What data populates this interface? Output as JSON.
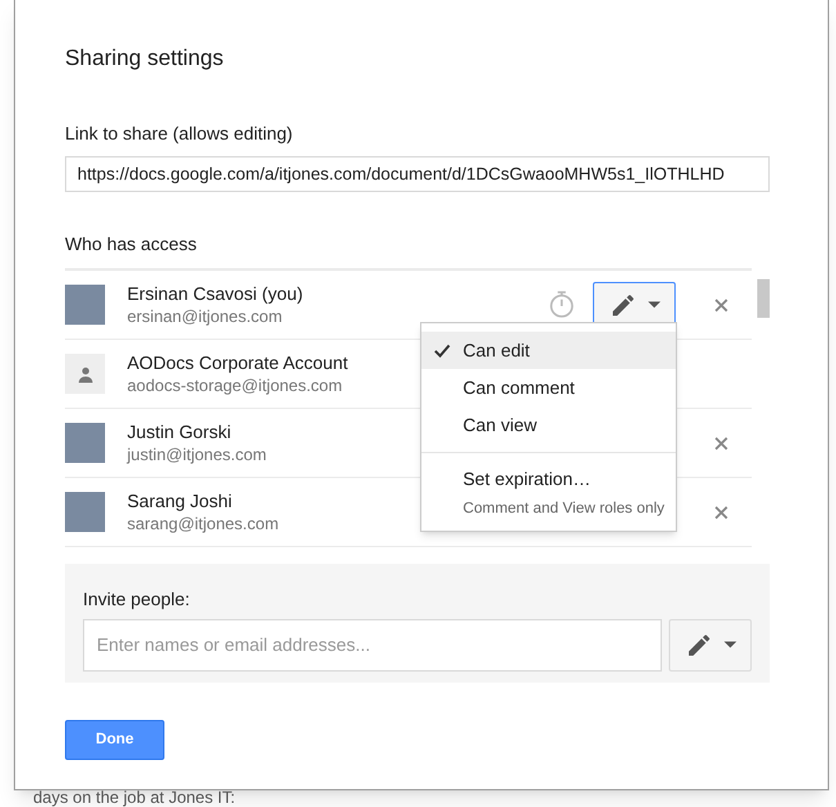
{
  "dialog": {
    "title": "Sharing settings"
  },
  "link": {
    "label": "Link to share (allows editing)",
    "value": "https://docs.google.com/a/itjones.com/document/d/1DCsGwaooMHW5s1_IlOTHLHD"
  },
  "access": {
    "label": "Who has access",
    "people": [
      {
        "name": "Ersinan Csavosi (you)",
        "email": "ersinan@itjones.com",
        "kind": "photo",
        "controls": true,
        "removable": true
      },
      {
        "name": "AODocs Corporate Account",
        "email": "aodocs-storage@itjones.com",
        "kind": "default",
        "controls": false,
        "removable": false
      },
      {
        "name": "Justin Gorski",
        "email": "justin@itjones.com",
        "kind": "photo",
        "controls": false,
        "removable": true
      },
      {
        "name": "Sarang Joshi",
        "email": "sarang@itjones.com",
        "kind": "photo",
        "controls": false,
        "removable": true
      }
    ]
  },
  "role_menu": {
    "items": [
      {
        "label": "Can edit",
        "selected": true
      },
      {
        "label": "Can comment",
        "selected": false
      },
      {
        "label": "Can view",
        "selected": false
      }
    ],
    "expiration": "Set expiration…",
    "note": "Comment and View roles only"
  },
  "invite": {
    "label": "Invite people:",
    "placeholder": "Enter names or email addresses..."
  },
  "done_button": "Done",
  "background_text": "days on the job at Jones IT:"
}
